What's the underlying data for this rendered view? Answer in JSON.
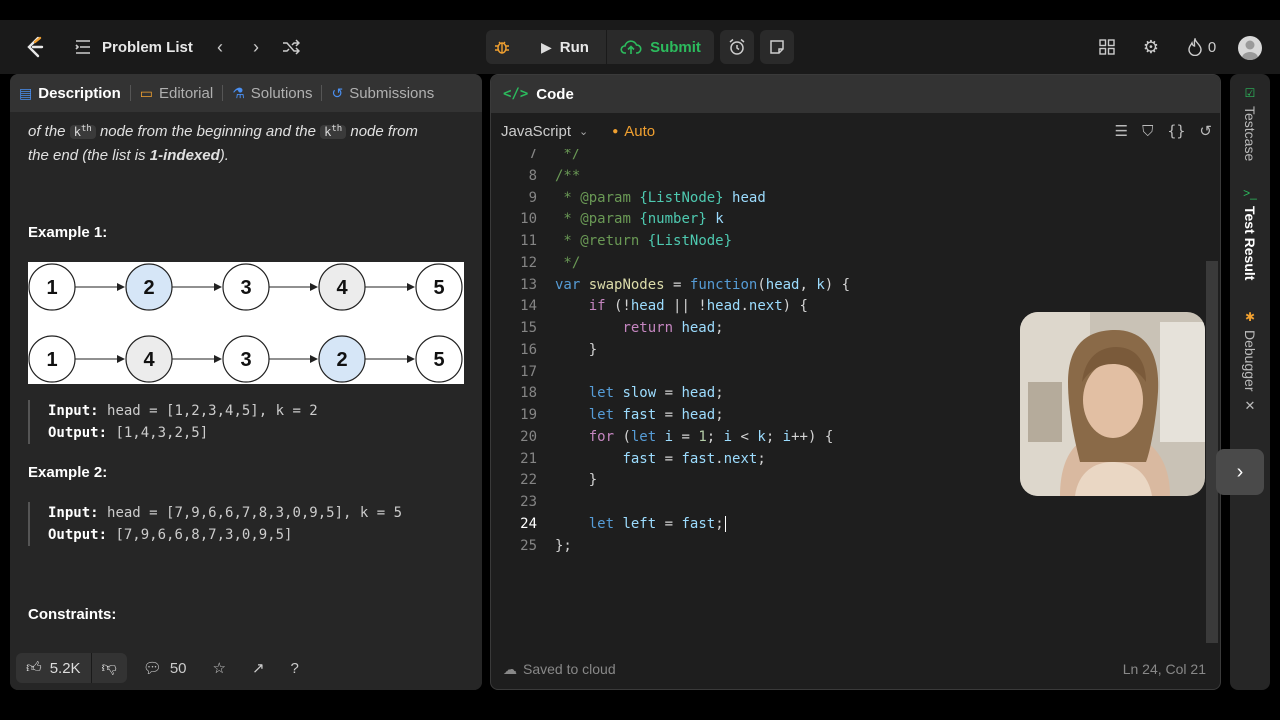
{
  "topbar": {
    "problem_list": "Problem List",
    "run_label": "Run",
    "submit_label": "Submit",
    "streak_count": "0"
  },
  "tabs": [
    {
      "label": "Description",
      "icon": "document-icon"
    },
    {
      "label": "Editorial",
      "icon": "book-icon"
    },
    {
      "label": "Solutions",
      "icon": "flask-icon"
    },
    {
      "label": "Submissions",
      "icon": "history-icon"
    }
  ],
  "description": {
    "line1_pre": "of the ",
    "k": "k",
    "th": "th",
    "line1_mid": " node from the beginning and the ",
    "line1_post": " node from",
    "line2_pre": "the end (the list is ",
    "line2_bold": "1-indexed",
    "line2_post": ")."
  },
  "example1": {
    "heading": "Example 1:",
    "top_row": [
      "1",
      "2",
      "3",
      "4",
      "5"
    ],
    "bottom_row": [
      "1",
      "4",
      "3",
      "2",
      "5"
    ],
    "input_label": "Input:",
    "input_value": "head = [1,2,3,4,5], k = 2",
    "output_label": "Output:",
    "output_value": "[1,4,3,2,5]"
  },
  "example2": {
    "heading": "Example 2:",
    "input_label": "Input:",
    "input_value": "head = [7,9,6,6,7,8,3,0,9,5], k = 5",
    "output_label": "Output:",
    "output_value": "[7,9,6,6,8,7,3,0,9,5]"
  },
  "constraints_heading": "Constraints:",
  "footer_left": {
    "likes": "5.2K",
    "comments": "50"
  },
  "code_panel": {
    "title": "Code",
    "language": "JavaScript",
    "auto": "Auto",
    "saved": "Saved to cloud",
    "cursor_pos": "Ln 24, Col 21"
  },
  "code_lines": [
    {
      "n": "7",
      "t": " */"
    },
    {
      "n": "8",
      "t": "/**"
    },
    {
      "n": "9",
      "t": " * @param {ListNode} head"
    },
    {
      "n": "10",
      "t": " * @param {number} k"
    },
    {
      "n": "11",
      "t": " * @return {ListNode}"
    },
    {
      "n": "12",
      "t": " */"
    },
    {
      "n": "13",
      "t": "var swapNodes = function(head, k) {"
    },
    {
      "n": "14",
      "t": "    if (!head || !head.next) {"
    },
    {
      "n": "15",
      "t": "        return head;"
    },
    {
      "n": "16",
      "t": "    }"
    },
    {
      "n": "17",
      "t": ""
    },
    {
      "n": "18",
      "t": "    let slow = head;"
    },
    {
      "n": "19",
      "t": "    let fast = head;"
    },
    {
      "n": "20",
      "t": "    for (let i = 1; i < k; i++) {"
    },
    {
      "n": "21",
      "t": "        fast = fast.next;"
    },
    {
      "n": "22",
      "t": "    }"
    },
    {
      "n": "23",
      "t": ""
    },
    {
      "n": "24",
      "t": "    let left = fast;"
    },
    {
      "n": "25",
      "t": "};"
    }
  ],
  "rail": {
    "testcase": "Testcase",
    "test_result": "Test Result",
    "debugger": "Debugger"
  },
  "colors": {
    "accent_blue": "#4a8ff0",
    "submit_green": "#2cbb5d",
    "auto_orange": "#f0a030",
    "node_highlight": "#d6e6f7",
    "node_gray": "#ececec"
  }
}
